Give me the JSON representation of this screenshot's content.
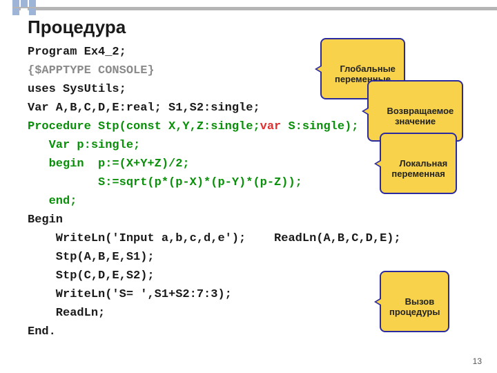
{
  "title": "Процедура",
  "code": {
    "l1": "Program Ex4_2;",
    "l2": "{$APPTYPE CONSOLE}",
    "l3": "uses SysUtils;",
    "l4": "Var A,B,C,D,E:real; S1,S2:single;",
    "l5a": "Procedure Stp(const X,Y,Z:single;",
    "l5b": "var",
    "l5c": " S:single);",
    "l6": "   Var p:single;",
    "l7": "   begin  p:=(X+Y+Z)/2;",
    "l8": "          S:=sqrt(p*(p-X)*(p-Y)*(p-Z));",
    "l9": "   end;",
    "l10": "Begin",
    "l11": "    WriteLn('Input a,b,c,d,e');    ReadLn(A,B,C,D,E);",
    "l12": "    Stp(A,B,E,S1);",
    "l13": "    Stp(C,D,E,S2);",
    "l14": "    WriteLn('S= ',S1+S2:7:3);",
    "l15": "    ReadLn;",
    "l16": "End."
  },
  "callouts": {
    "c1": "Глобальные\nпеременные",
    "c2": "Возвращаемое\nзначение",
    "c3": "Локальная\nпеременная",
    "c4": "Вызов\nпроцедуры"
  },
  "page_number": "13"
}
